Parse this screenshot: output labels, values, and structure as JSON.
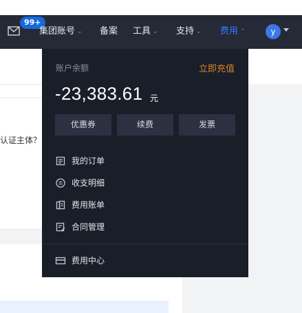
{
  "navbar": {
    "badge": "99+",
    "items": [
      {
        "label": "集团账号",
        "chevron": "⌄"
      },
      {
        "label": "备案"
      },
      {
        "label": "工具",
        "chevron": "⌄"
      },
      {
        "label": "支持",
        "chevron": "⌄"
      },
      {
        "label": "费用",
        "chevron": "⌃",
        "active": true
      }
    ],
    "avatar_initial": "y",
    "accent_color": "#2f7bff",
    "icons": {
      "mail": "mail-icon",
      "avatar_caret": "caret-down-icon"
    }
  },
  "background": {
    "card_text": "认证主体？)"
  },
  "billing_dropdown": {
    "balance_label": "账户余额",
    "recharge_link": "立即充值",
    "balance_amount": "-23,383.61",
    "balance_unit": "元",
    "buttons": [
      "优惠券",
      "续费",
      "发票"
    ],
    "menu": [
      {
        "label": "我的订单",
        "icon": "order-list-icon"
      },
      {
        "label": "收支明细",
        "icon": "transactions-icon"
      },
      {
        "label": "费用账单",
        "icon": "bill-icon"
      },
      {
        "label": "合同管理",
        "icon": "contract-icon"
      }
    ],
    "footer_item": {
      "label": "费用中心",
      "icon": "billing-center-icon"
    },
    "colors": {
      "panel_bg": "#1a1e28",
      "recharge": "#d9822b",
      "button_bg": "#2b3140"
    }
  }
}
